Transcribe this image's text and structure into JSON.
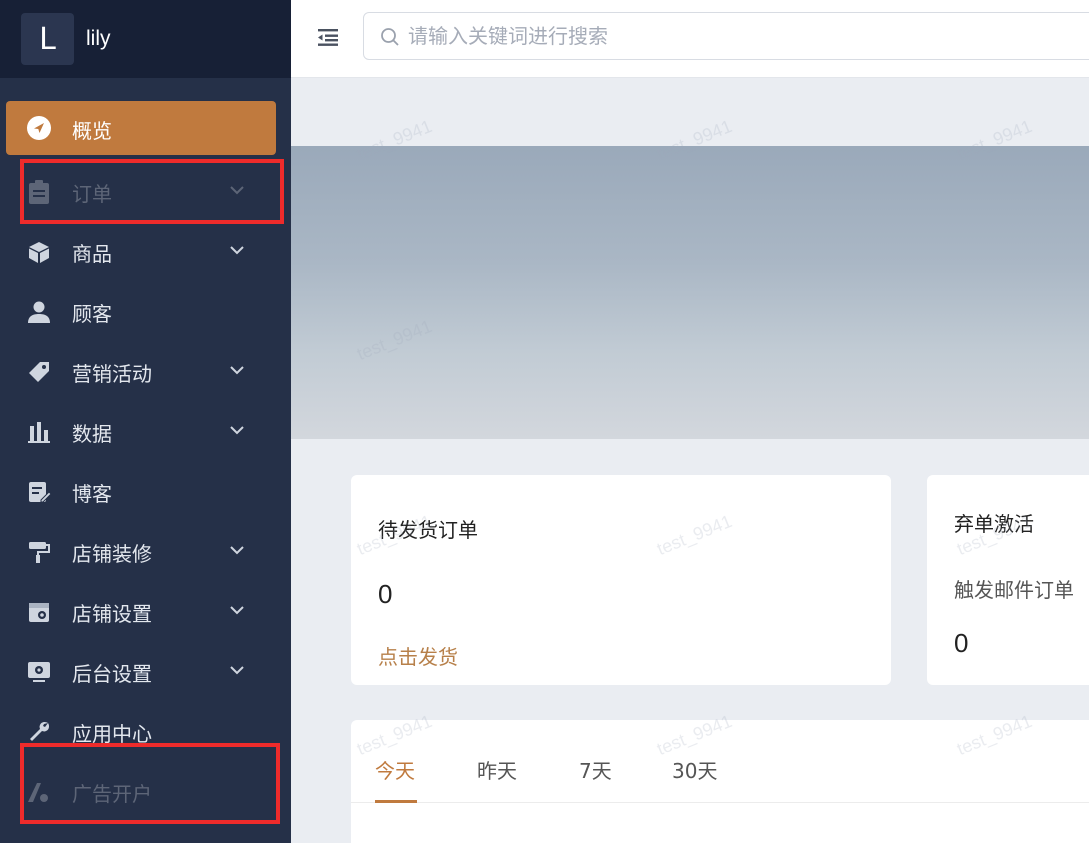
{
  "brand": {
    "logo_letter": "L",
    "store_name": "lily"
  },
  "sidebar": {
    "items": [
      {
        "label": "概览",
        "icon": "navigation-icon",
        "has_children": false
      },
      {
        "label": "订单",
        "icon": "clipboard-icon",
        "has_children": true
      },
      {
        "label": "商品",
        "icon": "box-icon",
        "has_children": true
      },
      {
        "label": "顾客",
        "icon": "user-icon",
        "has_children": false
      },
      {
        "label": "营销活动",
        "icon": "tag-icon",
        "has_children": true
      },
      {
        "label": "数据",
        "icon": "bar-chart-icon",
        "has_children": true
      },
      {
        "label": "博客",
        "icon": "edit-note-icon",
        "has_children": false
      },
      {
        "label": "店铺装修",
        "icon": "paint-roller-icon",
        "has_children": true
      },
      {
        "label": "店铺设置",
        "icon": "store-settings-icon",
        "has_children": true
      },
      {
        "label": "后台设置",
        "icon": "monitor-settings-icon",
        "has_children": true
      },
      {
        "label": "应用中心",
        "icon": "wrench-icon",
        "has_children": false
      },
      {
        "label": "广告开户",
        "icon": "ads-icon",
        "has_children": false
      }
    ],
    "active_index": 0
  },
  "search": {
    "placeholder": "请输入关键词进行搜索",
    "value": ""
  },
  "cards": {
    "pending_shipment": {
      "title": "待发货订单",
      "count": "0",
      "action": "点击发货"
    },
    "abandoned_cart": {
      "title": "弃单激活",
      "subtitle": "触发邮件订单",
      "count": "0"
    }
  },
  "tabs": {
    "items": [
      "今天",
      "昨天",
      "7天",
      "30天"
    ],
    "active_index": 0
  },
  "watermark_text": "test_9941",
  "colors": {
    "sidebar_bg": "#253048",
    "brand_bg": "#172036",
    "accent": "#c07a3e",
    "highlight": "#ee2b2b"
  }
}
